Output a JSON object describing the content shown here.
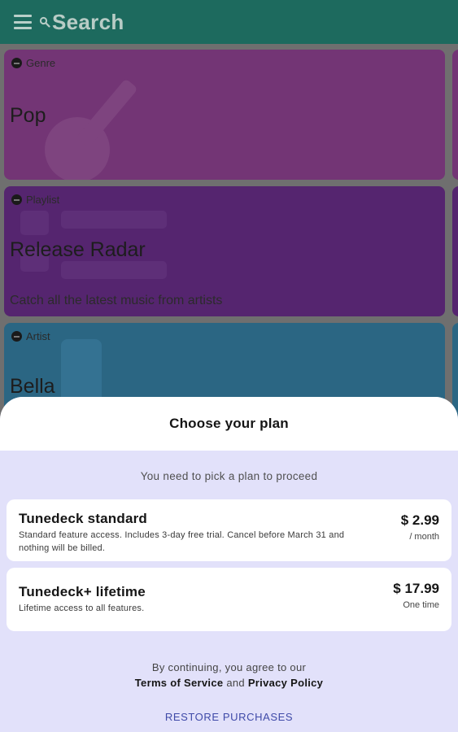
{
  "search": {
    "placeholder": "Search"
  },
  "cards": [
    {
      "kind": "Genre",
      "title": "Pop",
      "description": "",
      "color": "#733575"
    },
    {
      "kind": "Playlist",
      "title": "Release Radar",
      "description": "Catch all the latest music from artists",
      "color": "#55256f"
    },
    {
      "kind": "Artist",
      "title": "Bella",
      "description": "",
      "color": "#2b6683"
    }
  ],
  "sheet": {
    "title": "Choose your plan",
    "subtitle": "You need to pick a plan to proceed",
    "plans": [
      {
        "name": "Tunedeck standard",
        "description": "Standard feature access. Includes 3-day free trial. Cancel before March 31 and nothing will be billed.",
        "price": "$ 2.99",
        "period": "/ month"
      },
      {
        "name": "Tunedeck+ lifetime",
        "description": "Lifetime access to all features.",
        "price": "$ 17.99",
        "period": "One time"
      }
    ],
    "terms_prefix": "By continuing, you agree to our",
    "terms_link": "Terms of Service",
    "terms_and": "and",
    "privacy_link": "Privacy Policy",
    "restore_label": "RESTORE PURCHASES"
  },
  "colors": {
    "appbar": "#1d6a5e",
    "sheet_bg": "#e2e1fa",
    "accent": "#3f4aa8"
  }
}
